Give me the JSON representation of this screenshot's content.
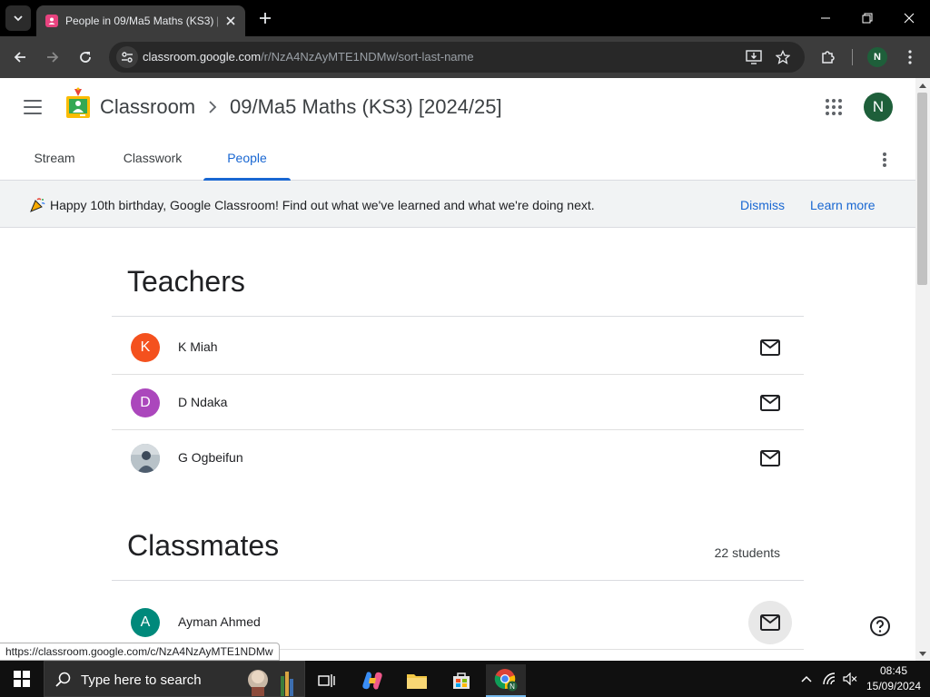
{
  "browser": {
    "tab_title": "People in 09/Ma5 Maths (KS3) [",
    "url_host": "classroom.google.com",
    "url_path": "/r/NzA4NzAyMTE1NDMw/sort-last-name",
    "profile_initial": "N",
    "status_url": "https://classroom.google.com/c/NzA4NzAyMTE1NDMw"
  },
  "header": {
    "app_name": "Classroom",
    "class_name": "09/Ma5 Maths (KS3) [2024/25]",
    "user_initial": "N"
  },
  "tabs": [
    {
      "label": "Stream"
    },
    {
      "label": "Classwork"
    },
    {
      "label": "People"
    }
  ],
  "banner": {
    "text": "Happy 10th birthday, Google Classroom! Find out what we've learned and what we're doing next.",
    "dismiss": "Dismiss",
    "learn_more": "Learn more"
  },
  "teachers": {
    "title": "Teachers",
    "people": [
      {
        "initial": "K",
        "name": "K Miah",
        "color": "#f4511e"
      },
      {
        "initial": "D",
        "name": "D Ndaka",
        "color": "#ab47bc"
      },
      {
        "initial": "",
        "name": "G Ogbeifun",
        "color": "#8a9aa8"
      }
    ]
  },
  "classmates": {
    "title": "Classmates",
    "count": "22 students",
    "people": [
      {
        "initial": "A",
        "name": "Ayman Ahmed",
        "color": "#00897b"
      }
    ]
  },
  "taskbar": {
    "search_placeholder": "Type here to search",
    "time": "08:45",
    "date": "15/09/2024"
  },
  "colors": {
    "accent": "#1967d2",
    "active_tab_text": "#1967d2"
  }
}
